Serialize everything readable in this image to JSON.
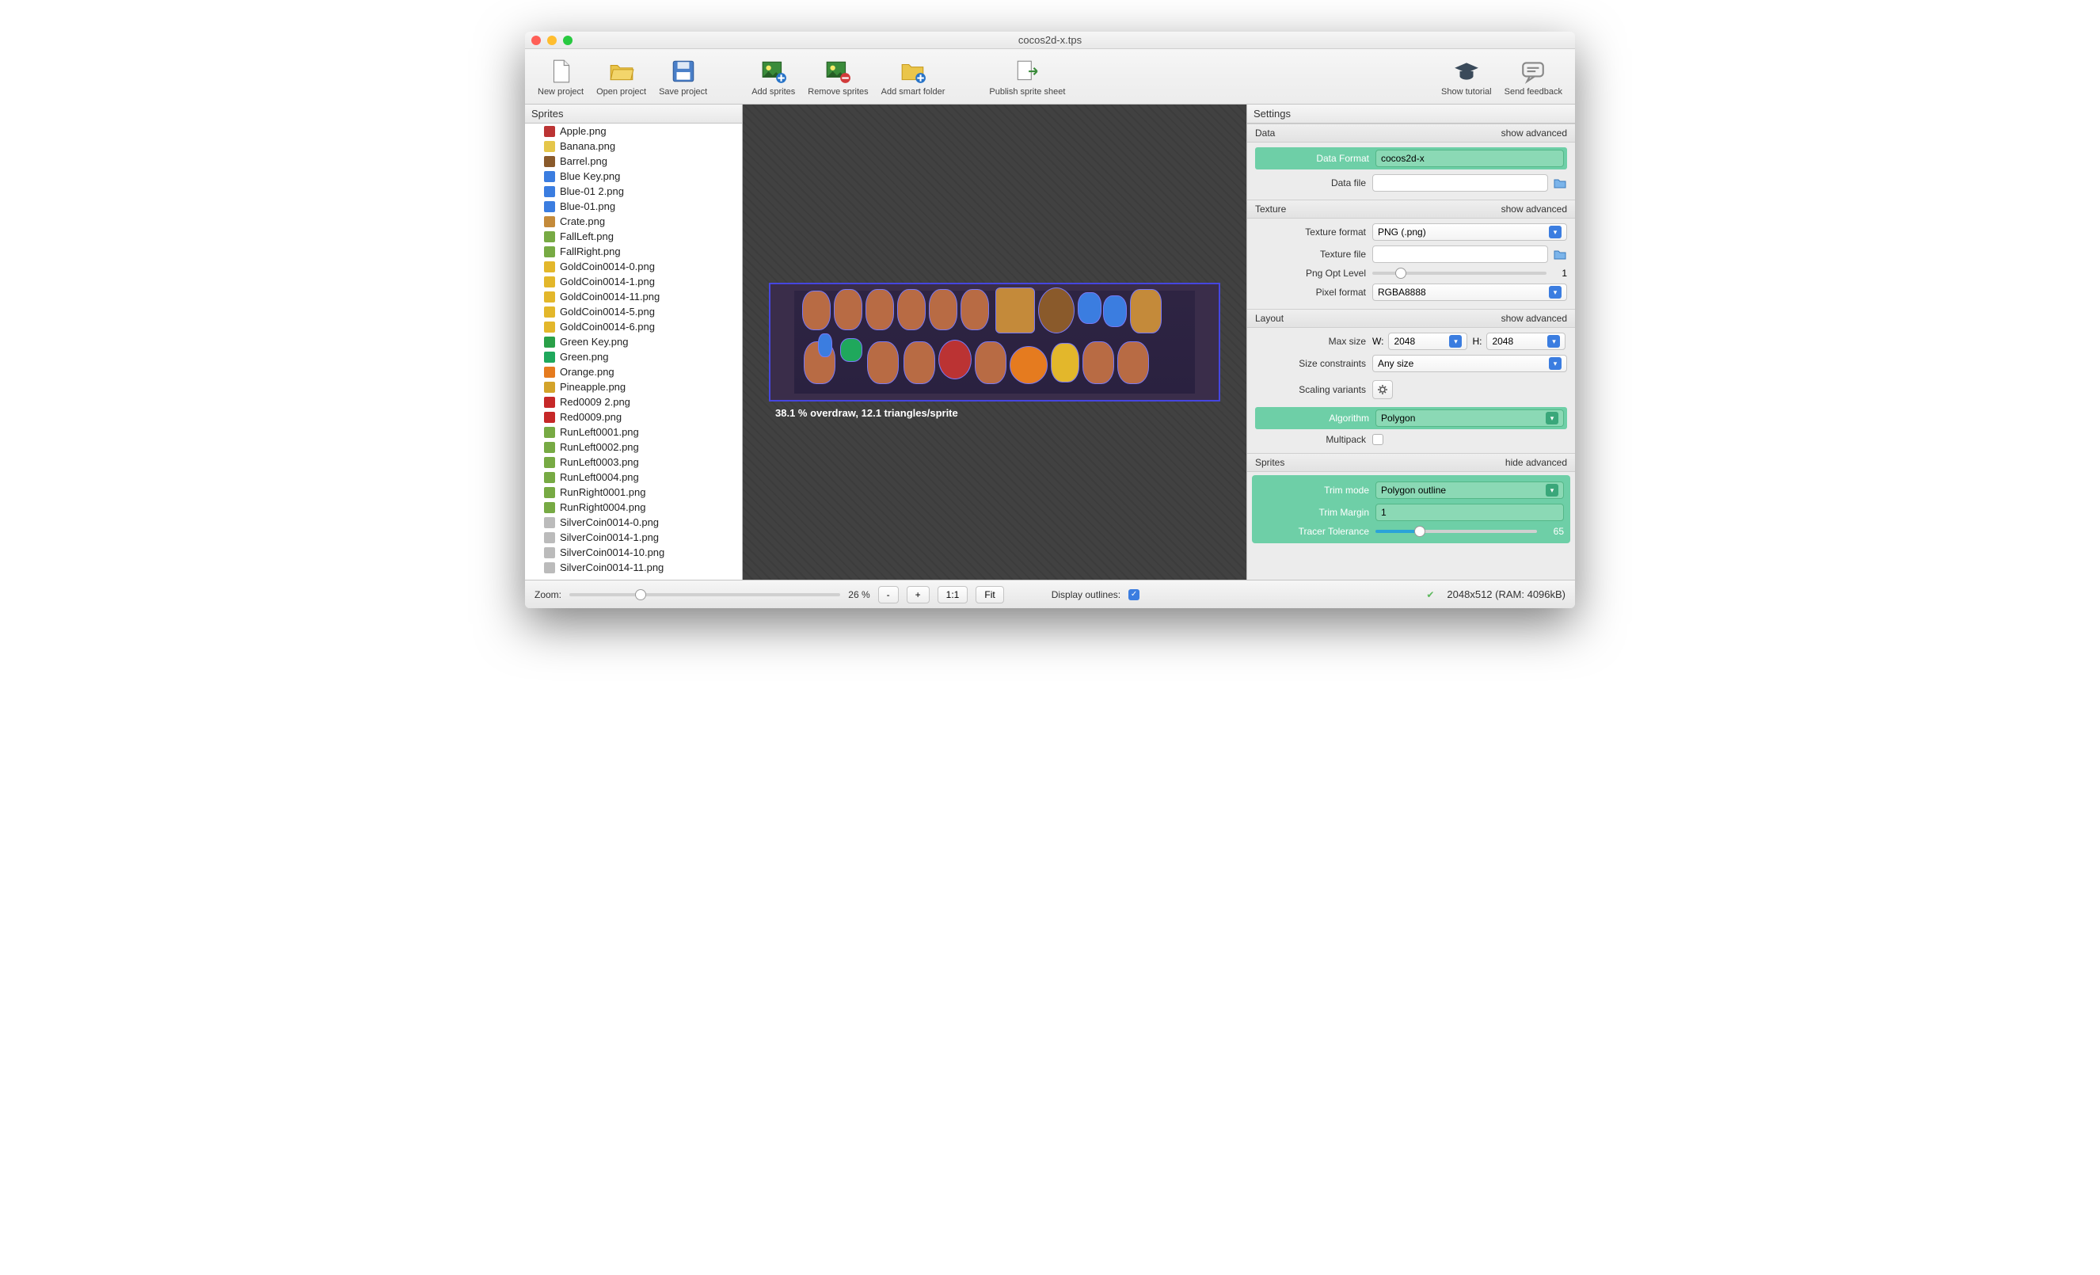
{
  "window": {
    "title": "cocos2d-x.tps"
  },
  "toolbar": {
    "new_project": "New project",
    "open_project": "Open project",
    "save_project": "Save project",
    "add_sprites": "Add sprites",
    "remove_sprites": "Remove sprites",
    "add_smart_folder": "Add smart folder",
    "publish": "Publish sprite sheet",
    "show_tutorial": "Show tutorial",
    "send_feedback": "Send feedback"
  },
  "left_panel": {
    "title": "Sprites"
  },
  "sprites": [
    {
      "name": "Apple.png",
      "color": "#b33"
    },
    {
      "name": "Banana.png",
      "color": "#e5c64a"
    },
    {
      "name": "Barrel.png",
      "color": "#8a5a2b"
    },
    {
      "name": "Blue Key.png",
      "color": "#3b7de0"
    },
    {
      "name": "Blue-01 2.png",
      "color": "#3b7de0"
    },
    {
      "name": "Blue-01.png",
      "color": "#3b7de0"
    },
    {
      "name": "Crate.png",
      "color": "#c48a3a"
    },
    {
      "name": "FallLeft.png",
      "color": "#7a4"
    },
    {
      "name": "FallRight.png",
      "color": "#7a4"
    },
    {
      "name": "GoldCoin0014-0.png",
      "color": "#e3b72b"
    },
    {
      "name": "GoldCoin0014-1.png",
      "color": "#e3b72b"
    },
    {
      "name": "GoldCoin0014-11.png",
      "color": "#e3b72b"
    },
    {
      "name": "GoldCoin0014-5.png",
      "color": "#e3b72b"
    },
    {
      "name": "GoldCoin0014-6.png",
      "color": "#e3b72b"
    },
    {
      "name": "Green Key.png",
      "color": "#2aa048"
    },
    {
      "name": "Green.png",
      "color": "#1fa85c"
    },
    {
      "name": "Orange.png",
      "color": "#e57b1f"
    },
    {
      "name": "Pineapple.png",
      "color": "#d3a32a"
    },
    {
      "name": "Red0009 2.png",
      "color": "#c62828"
    },
    {
      "name": "Red0009.png",
      "color": "#c62828"
    },
    {
      "name": "RunLeft0001.png",
      "color": "#7a4"
    },
    {
      "name": "RunLeft0002.png",
      "color": "#7a4"
    },
    {
      "name": "RunLeft0003.png",
      "color": "#7a4"
    },
    {
      "name": "RunLeft0004.png",
      "color": "#7a4"
    },
    {
      "name": "RunRight0001.png",
      "color": "#7a4"
    },
    {
      "name": "RunRight0004.png",
      "color": "#7a4"
    },
    {
      "name": "SilverCoin0014-0.png",
      "color": "#bbb"
    },
    {
      "name": "SilverCoin0014-1.png",
      "color": "#bbb"
    },
    {
      "name": "SilverCoin0014-10.png",
      "color": "#bbb"
    },
    {
      "name": "SilverCoin0014-11.png",
      "color": "#bbb"
    }
  ],
  "canvas": {
    "overdraw": "38.1 % overdraw, 12.1 triangles/sprite"
  },
  "settings": {
    "title": "Settings",
    "show_adv": "show advanced",
    "hide_adv": "hide advanced",
    "data": {
      "title": "Data",
      "format_label": "Data Format",
      "format_value": "cocos2d-x",
      "file_label": "Data file",
      "file_value": ""
    },
    "texture": {
      "title": "Texture",
      "format_label": "Texture format",
      "format_value": "PNG (.png)",
      "file_label": "Texture file",
      "file_value": "",
      "png_opt_label": "Png Opt Level",
      "png_opt_value": "1",
      "pixel_label": "Pixel format",
      "pixel_value": "RGBA8888"
    },
    "layout": {
      "title": "Layout",
      "max_size_label": "Max size",
      "w_label": "W:",
      "w_value": "2048",
      "h_label": "H:",
      "h_value": "2048",
      "constraints_label": "Size constraints",
      "constraints_value": "Any size",
      "scaling_label": "Scaling variants",
      "algorithm_label": "Algorithm",
      "algorithm_value": "Polygon",
      "multipack_label": "Multipack"
    },
    "sprites_sec": {
      "title": "Sprites",
      "trim_mode_label": "Trim mode",
      "trim_mode_value": "Polygon outline",
      "trim_margin_label": "Trim Margin",
      "trim_margin_value": "1",
      "tolerance_label": "Tracer Tolerance",
      "tolerance_value": "65"
    }
  },
  "status": {
    "zoom_label": "Zoom:",
    "zoom_value": "26 %",
    "minus": "-",
    "plus": "+",
    "one_one": "1:1",
    "fit": "Fit",
    "outlines_label": "Display outlines:",
    "outlines_checked": true,
    "info": "2048x512 (RAM: 4096kB)"
  }
}
